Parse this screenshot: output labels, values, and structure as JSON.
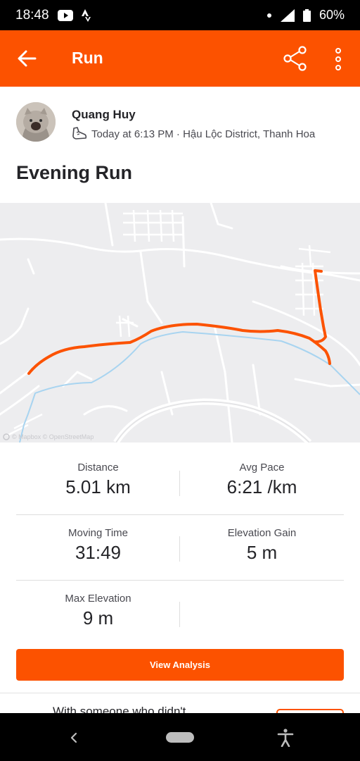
{
  "status_bar": {
    "time": "18:48",
    "battery": "60%"
  },
  "appbar": {
    "title": "Run"
  },
  "activity": {
    "athlete": "Quang Huy",
    "meta": "Today at 6:13 PM · Hậu Lộc District, Thanh Hoa",
    "title": "Evening Run"
  },
  "map": {
    "attribution": "© Mapbox © OpenStreetMap",
    "route_color": "#fc5200",
    "river_color": "#a8d4f0"
  },
  "stats": [
    [
      {
        "label": "Distance",
        "value": "5.01 km"
      },
      {
        "label": "Avg Pace",
        "value": "6:21 /km"
      }
    ],
    [
      {
        "label": "Moving Time",
        "value": "31:49"
      },
      {
        "label": "Elevation Gain",
        "value": "5 m"
      }
    ],
    [
      {
        "label": "Max Elevation",
        "value": "9 m"
      }
    ]
  ],
  "cta": {
    "label": "View Analysis"
  },
  "peek": {
    "text": "With someone who didn't..."
  },
  "colors": {
    "brand": "#fc5200",
    "status_bar": "#000000"
  }
}
